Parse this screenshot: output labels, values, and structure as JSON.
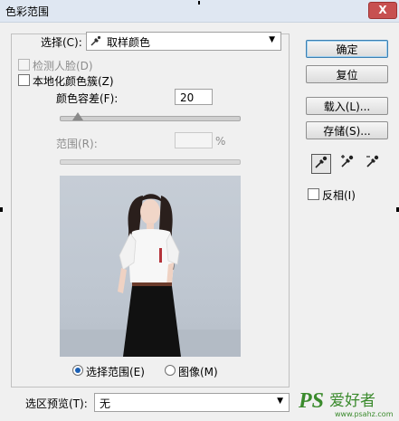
{
  "window": {
    "title": "色彩范围",
    "close_glyph": "X"
  },
  "select": {
    "label": "选择(C):",
    "value": "取样颜色"
  },
  "detect_faces": {
    "label": "检测人脸(D)",
    "checked": false,
    "enabled": false
  },
  "localized_clusters": {
    "label": "本地化颜色簇(Z)",
    "checked": false
  },
  "fuzziness": {
    "label": "颜色容差(F):",
    "value": "20",
    "slider_fraction": 0.1
  },
  "range": {
    "label": "范围(R):",
    "value": "",
    "unit": "%",
    "enabled": false
  },
  "preview_mode": {
    "options": [
      "选择范围(E)",
      "图像(M)"
    ],
    "selected": 0
  },
  "selection_preview": {
    "label": "选区预览(T):",
    "value": "无"
  },
  "buttons": {
    "ok": "确定",
    "reset": "复位",
    "load": "载入(L)...",
    "save": "存储(S)..."
  },
  "eyedroppers": [
    "eyedropper-icon",
    "eyedropper-plus-icon",
    "eyedropper-minus-icon"
  ],
  "invert": {
    "label": "反相(I)",
    "checked": false
  },
  "watermark": {
    "logo": "PS",
    "text": "爱好者",
    "url": "www.psahz.com"
  },
  "colors": {
    "title_bar": "#dfe7f2",
    "close_button": "#c75050",
    "dialog_bg": "#f0f0f0",
    "preview_bg": "#c2cad4",
    "watermark_green": "#3a8a2c"
  }
}
